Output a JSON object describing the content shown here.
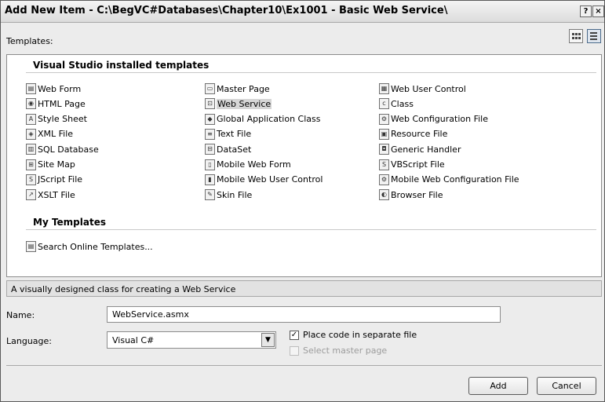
{
  "window": {
    "title": "Add New Item - C:\\BegVC#Databases\\Chapter10\\Ex1001 - Basic Web Service\\",
    "help_icon": "question-mark-icon",
    "close_icon": "close-icon"
  },
  "templates": {
    "label": "Templates:",
    "view_large_icons": "large-icons-view-icon",
    "view_small_icons": "small-icons-view-icon",
    "installed_header": "Visual Studio installed templates",
    "installed": [
      {
        "label": "Web Form",
        "icon": "web-form-icon"
      },
      {
        "label": "HTML Page",
        "icon": "html-page-icon"
      },
      {
        "label": "Style Sheet",
        "icon": "style-sheet-icon"
      },
      {
        "label": "XML File",
        "icon": "xml-file-icon"
      },
      {
        "label": "SQL Database",
        "icon": "sql-database-icon"
      },
      {
        "label": "Site Map",
        "icon": "site-map-icon"
      },
      {
        "label": "JScript File",
        "icon": "jscript-file-icon"
      },
      {
        "label": "XSLT File",
        "icon": "xslt-file-icon"
      },
      {
        "label": "Master Page",
        "icon": "master-page-icon"
      },
      {
        "label": "Web Service",
        "icon": "web-service-icon",
        "selected": true
      },
      {
        "label": "Global Application Class",
        "icon": "global-application-class-icon"
      },
      {
        "label": "Text File",
        "icon": "text-file-icon"
      },
      {
        "label": "DataSet",
        "icon": "dataset-icon"
      },
      {
        "label": "Mobile Web Form",
        "icon": "mobile-web-form-icon"
      },
      {
        "label": "Mobile Web User Control",
        "icon": "mobile-web-user-control-icon"
      },
      {
        "label": "Skin File",
        "icon": "skin-file-icon"
      },
      {
        "label": "Web User Control",
        "icon": "web-user-control-icon"
      },
      {
        "label": "Class",
        "icon": "class-icon"
      },
      {
        "label": "Web Configuration File",
        "icon": "web-configuration-file-icon"
      },
      {
        "label": "Resource File",
        "icon": "resource-file-icon"
      },
      {
        "label": "Generic Handler",
        "icon": "generic-handler-icon"
      },
      {
        "label": "VBScript File",
        "icon": "vbscript-file-icon"
      },
      {
        "label": "Mobile Web Configuration File",
        "icon": "mobile-web-configuration-file-icon"
      },
      {
        "label": "Browser File",
        "icon": "browser-file-icon"
      }
    ],
    "my_header": "My Templates",
    "my": [
      {
        "label": "Search Online Templates...",
        "icon": "search-online-templates-icon"
      }
    ]
  },
  "description": "A visually designed class for creating a Web Service",
  "form": {
    "name_label": "Name:",
    "name_value": "WebService.asmx",
    "language_label": "Language:",
    "language_value": "Visual C#",
    "place_code_label": "Place code in separate file",
    "place_code_checked": true,
    "select_master_label": "Select master page",
    "select_master_checked": false,
    "select_master_enabled": false
  },
  "buttons": {
    "add": "Add",
    "cancel": "Cancel"
  }
}
